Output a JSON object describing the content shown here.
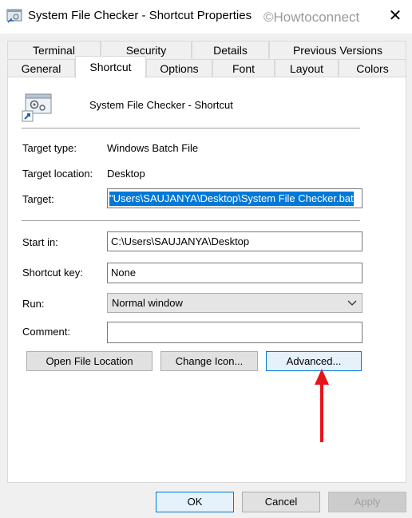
{
  "window": {
    "title": "System File Checker - Shortcut Properties",
    "watermark": "©Howtoconnect",
    "close_glyph": "✕"
  },
  "tabs": {
    "row1": [
      {
        "label": "Terminal"
      },
      {
        "label": "Security"
      },
      {
        "label": "Details"
      },
      {
        "label": "Previous Versions"
      }
    ],
    "row2": [
      {
        "label": "General"
      },
      {
        "label": "Shortcut"
      },
      {
        "label": "Options"
      },
      {
        "label": "Font"
      },
      {
        "label": "Layout"
      },
      {
        "label": "Colors"
      }
    ],
    "active": "Shortcut"
  },
  "shortcut": {
    "name": "System File Checker - Shortcut",
    "target_type_label": "Target type:",
    "target_type_value": "Windows Batch File",
    "target_location_label": "Target location:",
    "target_location_value": "Desktop",
    "target_label": "Target:",
    "target_value": "Users\\SAUJANYA\\Desktop\\System File Checker.bat\"",
    "start_in_label": "Start in:",
    "start_in_value": "C:\\Users\\SAUJANYA\\Desktop",
    "shortcut_key_label": "Shortcut key:",
    "shortcut_key_value": "None",
    "run_label": "Run:",
    "run_value": "Normal window",
    "comment_label": "Comment:",
    "comment_value": "",
    "open_file_location": "Open File Location",
    "change_icon": "Change Icon...",
    "advanced": "Advanced..."
  },
  "footer": {
    "ok": "OK",
    "cancel": "Cancel",
    "apply": "Apply"
  },
  "colors": {
    "selection": "#0078d7",
    "annotation_arrow": "#e8141a"
  }
}
